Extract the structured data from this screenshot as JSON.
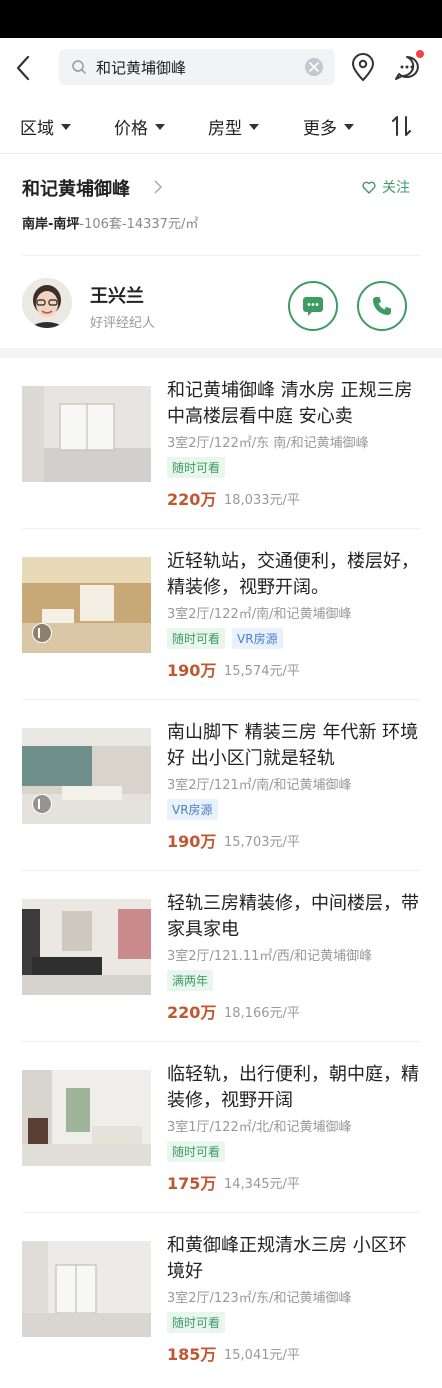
{
  "search": {
    "query": "和记黄埔御峰",
    "back_icon": "chevron-left-icon",
    "location_icon": "location-pin-icon",
    "message_icon": "message-icon"
  },
  "filters": [
    {
      "label": "区域"
    },
    {
      "label": "价格"
    },
    {
      "label": "房型"
    },
    {
      "label": "更多"
    }
  ],
  "community": {
    "name": "和记黄埔御峰",
    "follow_label": "关注",
    "district": "南岸-南坪",
    "stats": "-106套-14337元/㎡"
  },
  "agent": {
    "name": "王兴兰",
    "subtitle": "好评经纪人"
  },
  "listings": [
    {
      "title": "和记黄埔御峰 清水房 正规三房 中高楼层看中庭 安心卖",
      "spec": "3室2厅/122㎡/东 南/和记黄埔御峰",
      "tags": [
        {
          "text": "随时可看",
          "style": "green"
        }
      ],
      "price": "220万",
      "unit_price": "18,033元/平"
    },
    {
      "title": "近轻轨站，交通便利，楼层好，精装修，视野开阔。",
      "spec": "3室2厅/122㎡/南/和记黄埔御峰",
      "tags": [
        {
          "text": "随时可看",
          "style": "green"
        },
        {
          "text": "VR房源",
          "style": "blue"
        }
      ],
      "price": "190万",
      "unit_price": "15,574元/平"
    },
    {
      "title": "南山脚下 精装三房 年代新 环境好 出小区门就是轻轨",
      "spec": "3室2厅/121㎡/南/和记黄埔御峰",
      "tags": [
        {
          "text": "VR房源",
          "style": "blue"
        }
      ],
      "price": "190万",
      "unit_price": "15,703元/平"
    },
    {
      "title": "轻轨三房精装修，中间楼层，带家具家电",
      "spec": "3室2厅/121.11㎡/西/和记黄埔御峰",
      "tags": [
        {
          "text": "满两年",
          "style": "green"
        }
      ],
      "price": "220万",
      "unit_price": "18,166元/平"
    },
    {
      "title": "临轻轨，出行便利，朝中庭，精装修，视野开阔",
      "spec": "3室1厅/122㎡/北/和记黄埔御峰",
      "tags": [
        {
          "text": "随时可看",
          "style": "green"
        }
      ],
      "price": "175万",
      "unit_price": "14,345元/平"
    },
    {
      "title": "和黄御峰正规清水三房 小区环境好",
      "spec": "3室2厅/123㎡/东/和记黄埔御峰",
      "tags": [
        {
          "text": "随时可看",
          "style": "green"
        }
      ],
      "price": "185万",
      "unit_price": "15,041元/平"
    }
  ],
  "colors": {
    "accent": "#3f9b64",
    "price": "#c0572f",
    "tag_blue": "#4a7fc9"
  }
}
